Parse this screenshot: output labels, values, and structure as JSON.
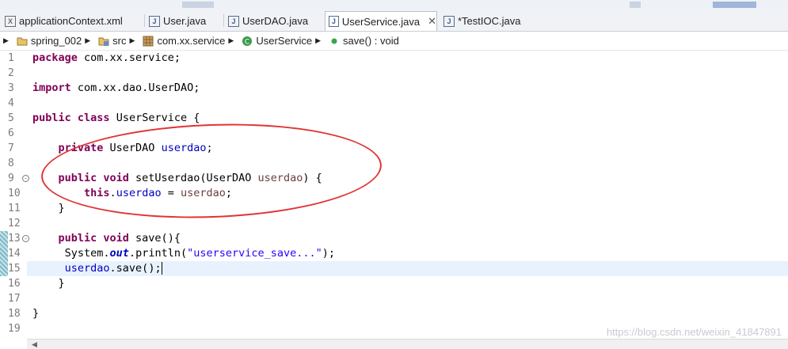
{
  "tabs": [
    {
      "label": "applicationContext.xml",
      "icon": "xml-file-icon",
      "active": false
    },
    {
      "label": "User.java",
      "icon": "java-file-icon",
      "active": false
    },
    {
      "label": "UserDAO.java",
      "icon": "java-file-icon",
      "active": false
    },
    {
      "label": "UserService.java",
      "icon": "java-file-icon",
      "active": true,
      "close": "✕"
    },
    {
      "label": "*TestIOC.java",
      "icon": "java-file-icon",
      "active": false
    }
  ],
  "breadcrumb": [
    {
      "label": "spring_002",
      "icon": "project-icon"
    },
    {
      "label": "src",
      "icon": "source-folder-icon"
    },
    {
      "label": "com.xx.service",
      "icon": "package-icon"
    },
    {
      "label": "UserService",
      "icon": "class-icon"
    },
    {
      "label": "save() : void",
      "icon": "method-icon"
    }
  ],
  "line_numbers": [
    "1",
    "2",
    "3",
    "4",
    "5",
    "6",
    "7",
    "8",
    "9",
    "10",
    "11",
    "12",
    "13",
    "14",
    "15",
    "16",
    "17",
    "18",
    "19"
  ],
  "code": {
    "l1_kw": "package",
    "l1_rest": " com.xx.service;",
    "l3_kw": "import",
    "l3_rest": " com.xx.dao.UserDAO;",
    "l5_kw1": "public",
    "l5_kw2": " class",
    "l5_rest": " UserService {",
    "l7_kw": "    private",
    "l7_type": " UserDAO ",
    "l7_fld": "userdao",
    "l7_end": ";",
    "l9_kw1": "    public",
    "l9_kw2": " void",
    "l9_mid": " setUserdao(UserDAO ",
    "l9_par": "userdao",
    "l9_end": ") {",
    "l10_kw": "        this",
    "l10_dot": ".",
    "l10_fld": "userdao",
    "l10_eq": " = ",
    "l10_par": "userdao",
    "l10_end": ";",
    "l11": "    }",
    "l13_kw1": "    public",
    "l13_kw2": " void",
    "l13_rest": " save(){",
    "l14_pre": "     System.",
    "l14_out": "out",
    "l14_mid": ".println(",
    "l14_str": "\"userservice_save...\"",
    "l14_end": ");",
    "l15_pre": "     ",
    "l15_fld": "userdao",
    "l15_rest": ".save();",
    "l16": "    }",
    "l18": "}"
  },
  "watermark": "https://blog.csdn.net/weixin_41847891",
  "colors": {
    "keyword": "#7f0055",
    "field": "#0000c0",
    "string": "#2a00ff",
    "annotation_circle": "#e03434"
  }
}
